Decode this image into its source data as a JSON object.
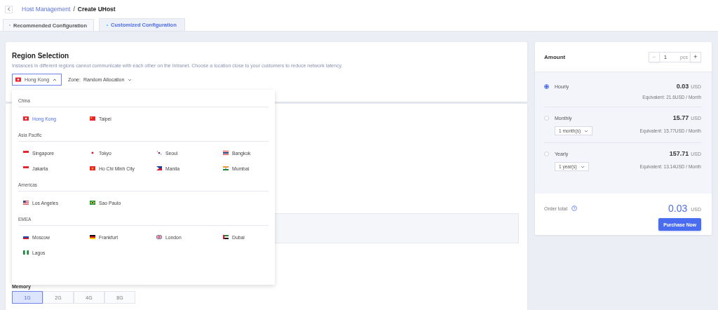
{
  "breadcrumb": {
    "parent": "Host Management",
    "separator": "/",
    "current": "Create UHost"
  },
  "tabs": [
    {
      "label": "Recommended Configuration",
      "selected": false
    },
    {
      "label": "Customized Configuration",
      "selected": true
    }
  ],
  "region_selection": {
    "title": "Region Selection",
    "description": "Instances in different regions cannot communicate with each other on the Intranet. Choose a location close to your customers to reduce network latency.",
    "region_select": {
      "value": "Hong Kong",
      "kind": "hongkong",
      "expanded": true
    },
    "zone_label": "Zone:",
    "zone_value": "Random Allocation"
  },
  "region_dropdown": {
    "groups": [
      {
        "name": "China",
        "cities": [
          {
            "name": "Hong Kong",
            "kind": "hongkong",
            "selected": true
          },
          {
            "name": "Taipei",
            "kind": "china",
            "selected": false
          }
        ]
      },
      {
        "name": "Asia Pacific",
        "cities": [
          {
            "name": "Singapore",
            "kind": "singapore",
            "selected": false
          },
          {
            "name": "Tokyo",
            "kind": "japan",
            "selected": false
          },
          {
            "name": "Seoul",
            "kind": "korea",
            "selected": false
          },
          {
            "name": "Bangkok",
            "kind": "thailand",
            "selected": false
          },
          {
            "name": "Jakarta",
            "kind": "indonesia",
            "selected": false
          },
          {
            "name": "Ho Chi Minh City",
            "kind": "vietnam",
            "selected": false
          },
          {
            "name": "Manila",
            "kind": "philippines",
            "selected": false
          },
          {
            "name": "Mumbai",
            "kind": "india",
            "selected": false
          }
        ]
      },
      {
        "name": "Americas",
        "cities": [
          {
            "name": "Los Angeles",
            "kind": "usa",
            "selected": false
          },
          {
            "name": "Sao Paulo",
            "kind": "brazil",
            "selected": false
          }
        ]
      },
      {
        "name": "EMEA",
        "cities": [
          {
            "name": "Moscow",
            "kind": "russia",
            "selected": false
          },
          {
            "name": "Frankfurt",
            "kind": "germany",
            "selected": false
          },
          {
            "name": "London",
            "kind": "uk",
            "selected": false
          },
          {
            "name": "Dubai",
            "kind": "uae",
            "selected": false
          },
          {
            "name": "Lagos",
            "kind": "nigeria",
            "selected": false
          }
        ]
      }
    ]
  },
  "memory": {
    "label": "Memory",
    "options": [
      {
        "label": "1G",
        "selected": true
      },
      {
        "label": "2G",
        "selected": false
      },
      {
        "label": "4G",
        "selected": false
      },
      {
        "label": "8G",
        "selected": false
      }
    ]
  },
  "amount": {
    "label": "Amount",
    "decrement": "−",
    "decrement_disabled": true,
    "value": "1",
    "unit": "pcs",
    "increment": "+"
  },
  "plans": [
    {
      "name": "Hourly",
      "selected": true,
      "price": "0.03",
      "currency": "USD",
      "equivalent": "Equivalent: 21.6USD / Month"
    },
    {
      "name": "Monthly",
      "selected": false,
      "price": "15.77",
      "currency": "USD",
      "period": "1 month(s)",
      "equivalent": "Equivalent: 15.77USD / Month"
    },
    {
      "name": "Yearly",
      "selected": false,
      "price": "157.71",
      "currency": "USD",
      "period": "1 year(s)",
      "equivalent": "Equivalent: 13.14USD / Month"
    }
  ],
  "order_total": {
    "label": "Order total",
    "price": "0.03",
    "currency": "USD"
  },
  "purchase_button": "Purchase Now"
}
